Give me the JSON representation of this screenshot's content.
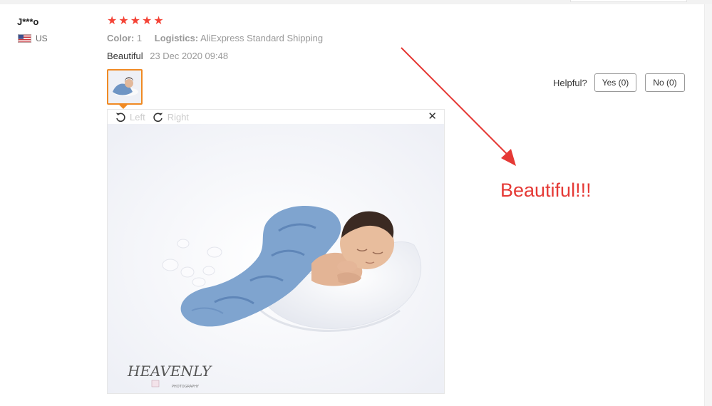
{
  "review": {
    "user_name": "J***o",
    "country": "US",
    "rating": 5,
    "stars": [
      "★",
      "★",
      "★",
      "★",
      "★"
    ],
    "color_label": "Color:",
    "color_value": "1",
    "logistics_label": "Logistics:",
    "logistics_value": "AliExpress Standard Shipping",
    "text": "Beautiful",
    "date": "23 Dec 2020 09:48"
  },
  "helpful": {
    "label": "Helpful?",
    "yes_label": "Yes (0)",
    "no_label": "No (0)"
  },
  "viewer": {
    "rotate_left_label": "Left",
    "rotate_right_label": "Right",
    "close_glyph": "✕",
    "watermark": "HEAVENLY",
    "watermark_sub": "PHOTOGRAPHY"
  },
  "annotation": {
    "text": "Beautiful!!!"
  },
  "colors": {
    "star": "#f44336",
    "thumb_border": "#f08a24",
    "annotation": "#e53935",
    "blanket": "#7fa4cf"
  }
}
